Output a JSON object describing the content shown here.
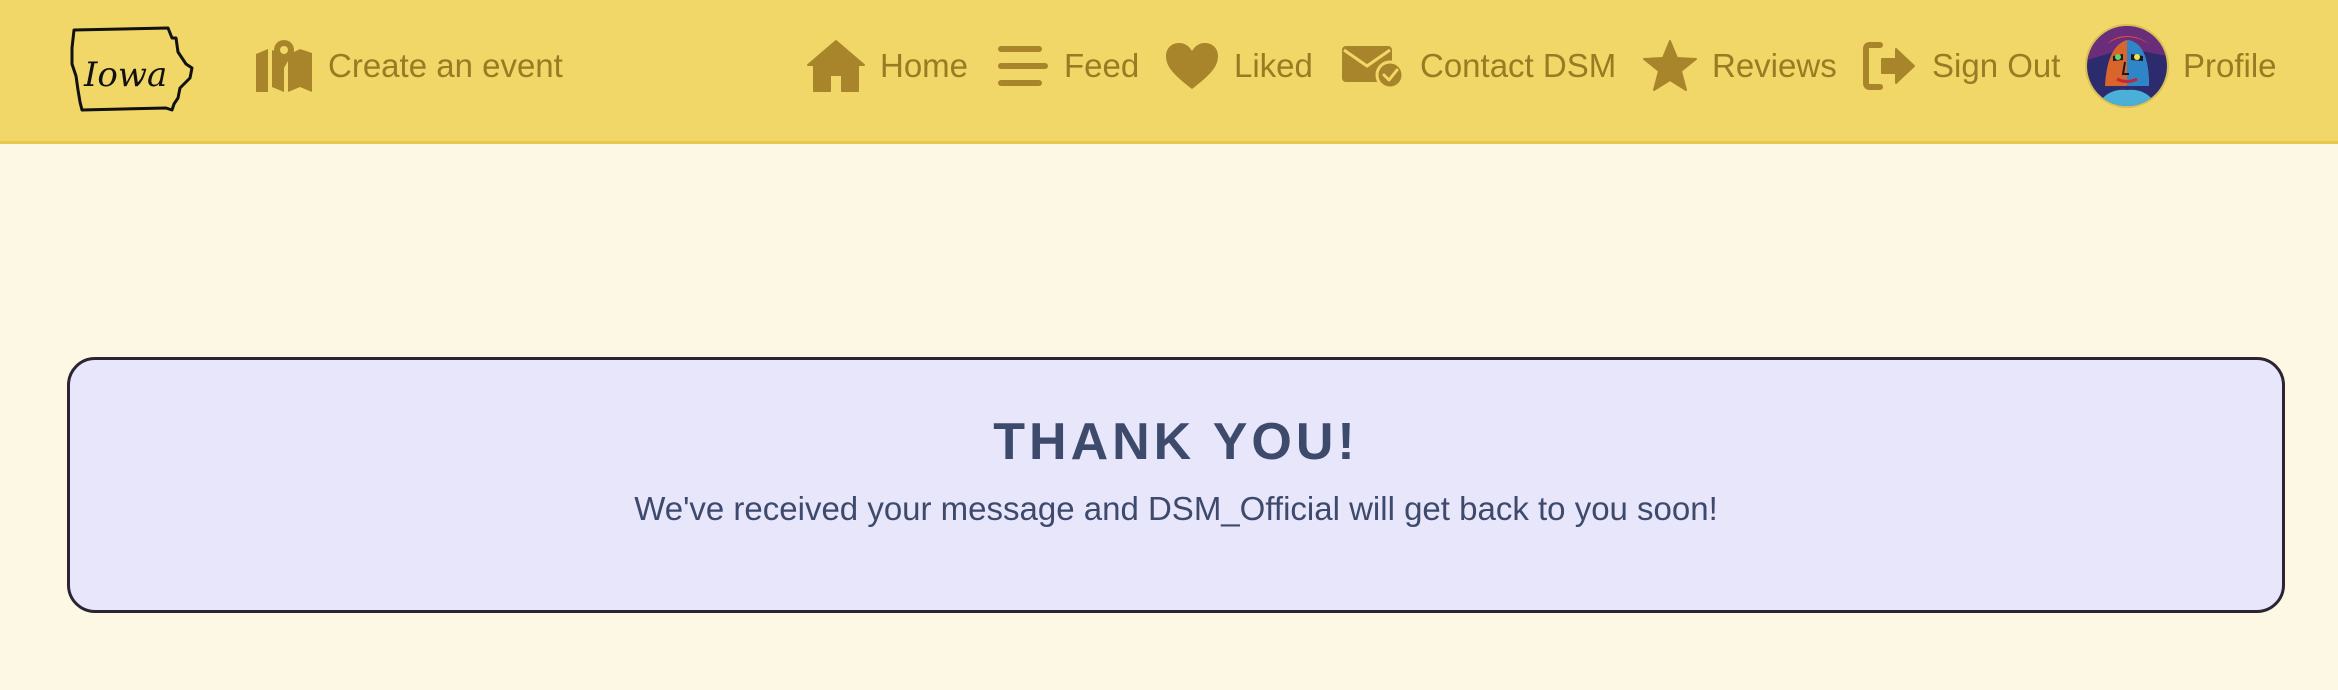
{
  "colors": {
    "navbar_bg": "#f0d767",
    "nav_text": "#9a7a22",
    "page_bg": "#fdf8e4",
    "card_bg": "#e8e6fb",
    "card_border": "#2b2433",
    "card_text": "#3d4a6c"
  },
  "navbar": {
    "logo": {
      "icon": "iowa-state-logo",
      "text": "Iowa"
    },
    "create_event": {
      "label": "Create an event",
      "icon": "map-pin-icon"
    },
    "items": [
      {
        "label": "Home",
        "icon": "home-icon"
      },
      {
        "label": "Feed",
        "icon": "feed-lines-icon"
      },
      {
        "label": "Liked",
        "icon": "heart-icon"
      },
      {
        "label": "Contact DSM",
        "icon": "envelope-check-icon"
      },
      {
        "label": "Reviews",
        "icon": "star-icon"
      },
      {
        "label": "Sign Out",
        "icon": "sign-out-icon"
      },
      {
        "label": "Profile",
        "icon": "avatar"
      }
    ]
  },
  "confirmation": {
    "title": "THANK YOU!",
    "message": "We've received your message and DSM_Official will get back to you soon!"
  }
}
